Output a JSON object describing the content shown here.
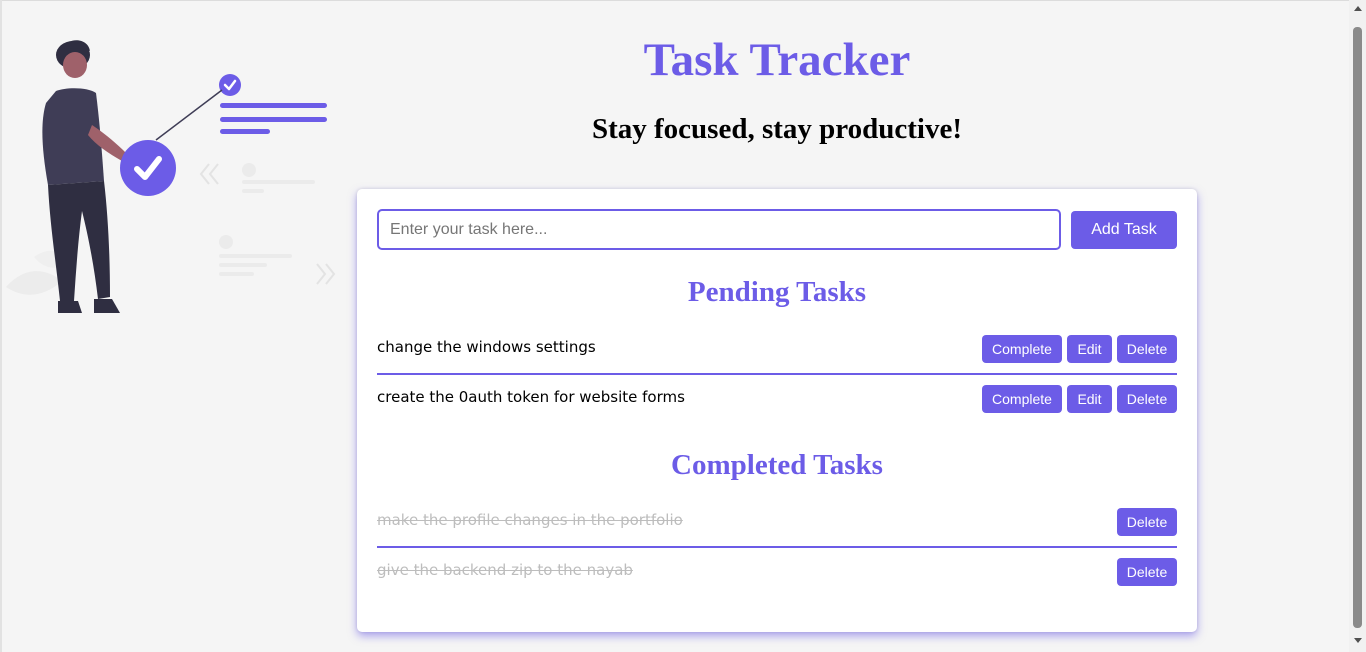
{
  "header": {
    "title": "Task Tracker",
    "subtitle": "Stay focused, stay productive!"
  },
  "input": {
    "placeholder": "Enter your task here...",
    "value": ""
  },
  "add_button_label": "Add Task",
  "pending": {
    "title": "Pending Tasks",
    "tasks": [
      {
        "text": "change the windows settings",
        "complete_label": "Complete",
        "edit_label": "Edit",
        "delete_label": "Delete"
      },
      {
        "text": "create the 0auth token for website forms",
        "complete_label": "Complete",
        "edit_label": "Edit",
        "delete_label": "Delete"
      }
    ]
  },
  "completed": {
    "title": "Completed Tasks",
    "tasks": [
      {
        "text": "make the profile changes in the portfolio",
        "delete_label": "Delete"
      },
      {
        "text": "give the backend zip to the nayab",
        "delete_label": "Delete"
      }
    ]
  },
  "illustration": {
    "icon": "person-with-checklist-illustration"
  },
  "colors": {
    "accent": "#6c5ce7",
    "background": "#f5f5f5",
    "card": "#ffffff",
    "completed_text": "#bdbdbd"
  }
}
